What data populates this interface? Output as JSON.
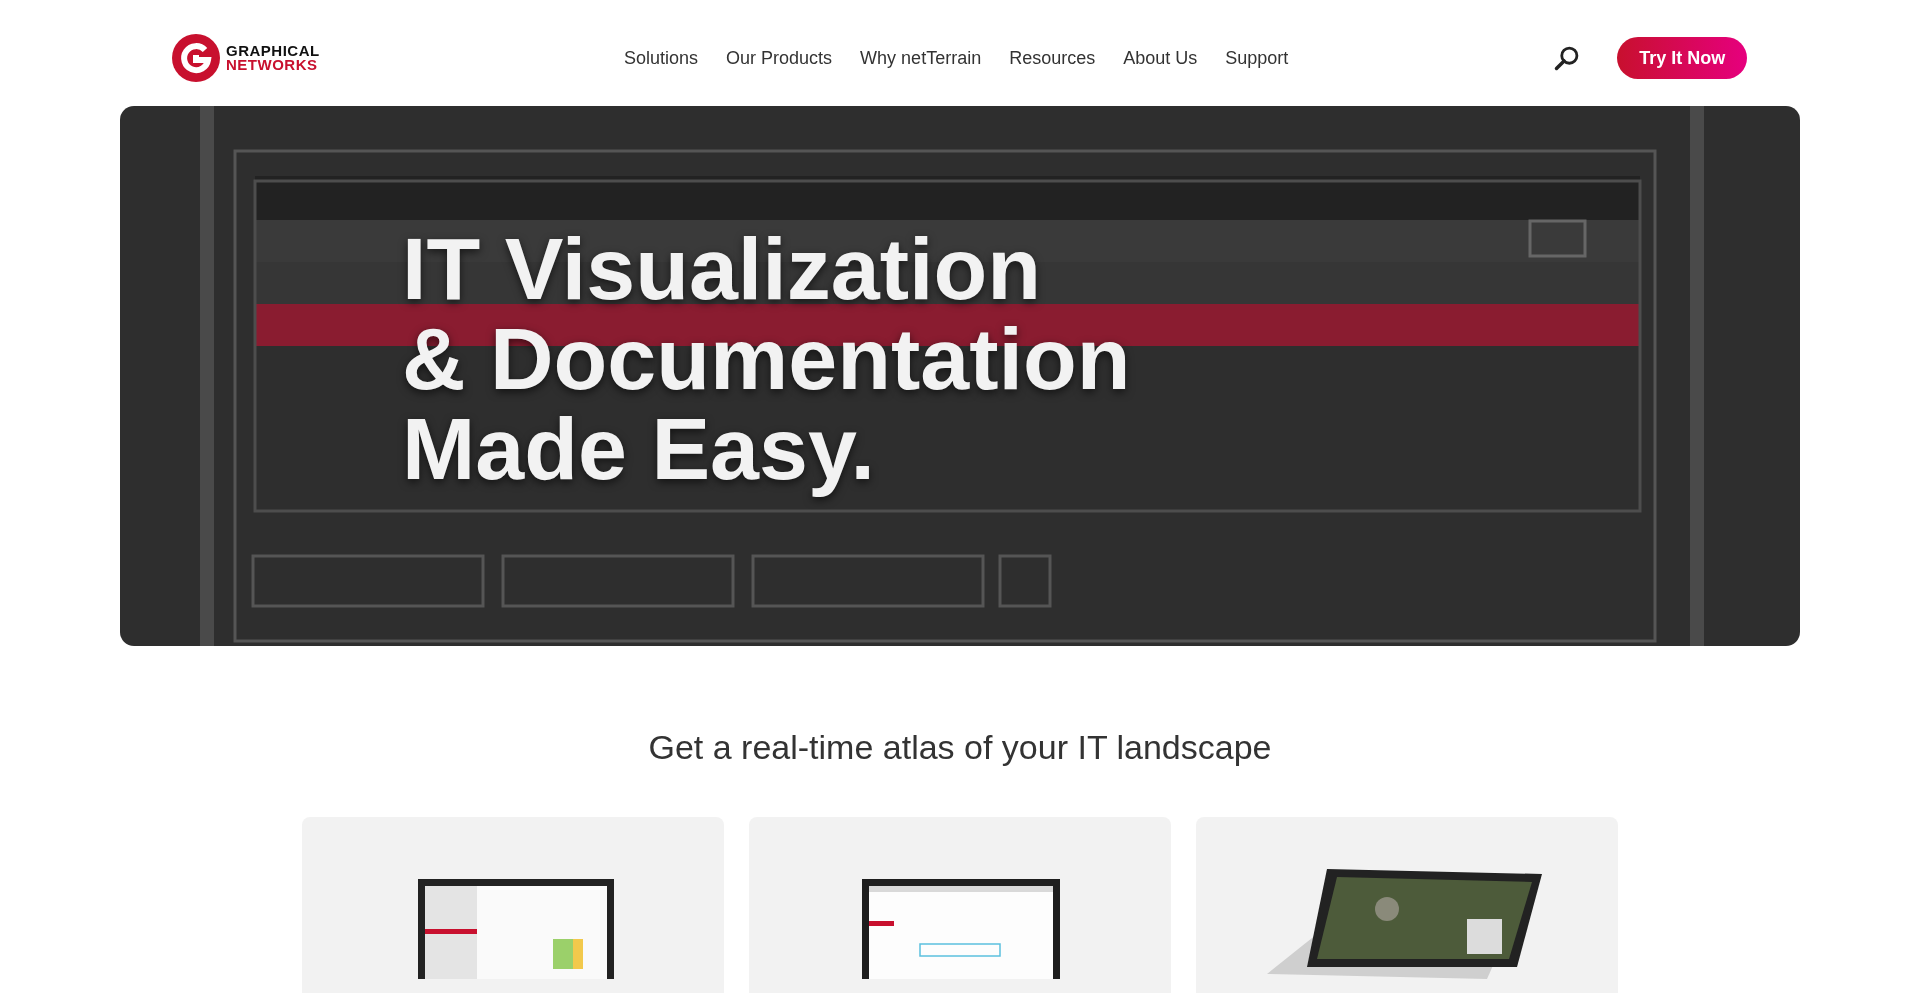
{
  "logo": {
    "line_1": "GRAPHICAL",
    "line_2": "NETWORKS"
  },
  "nav": [
    "Solutions",
    "Our Products",
    "Why netTerrain",
    "Resources",
    "About Us",
    "Support"
  ],
  "cta_button": "Try It Now",
  "hero": {
    "title_lines": [
      "IT Visualization",
      "& Documentation",
      "Made Easy."
    ]
  },
  "section_heading": "Get a real-time atlas of your IT landscape"
}
